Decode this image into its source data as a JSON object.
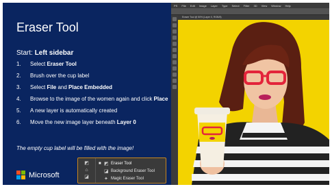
{
  "slide": {
    "title": "Eraser Tool",
    "start_prefix": "Start: ",
    "start_bold": "Left sidebar",
    "steps": [
      {
        "num": "1.",
        "pre": "Select ",
        "bold": "Eraser Tool",
        "mid": "",
        "bold2": "",
        "post": ""
      },
      {
        "num": "2.",
        "pre": "Brush over the cup label",
        "bold": "",
        "mid": "",
        "bold2": "",
        "post": ""
      },
      {
        "num": "3.",
        "pre": "Select ",
        "bold": "File",
        "mid": " and ",
        "bold2": "Place Embedded",
        "post": ""
      },
      {
        "num": "4.",
        "pre": "Browse to the image of the women again and click ",
        "bold": "Place",
        "mid": "",
        "bold2": "",
        "post": ""
      },
      {
        "num": "5.",
        "pre": "A new layer is automatically created",
        "bold": "",
        "mid": "",
        "bold2": "",
        "post": ""
      },
      {
        "num": "6.",
        "pre": "Move the new image layer beneath ",
        "bold": "Layer 0",
        "mid": "",
        "bold2": "",
        "post": ""
      }
    ],
    "note": "The empty cup label will be filled with the image!",
    "brand": "Microsoft"
  },
  "tool_popup": {
    "items": [
      {
        "label": "Eraser Tool",
        "icon": "eraser-icon",
        "active": true
      },
      {
        "label": "Background Eraser Tool",
        "icon": "background-eraser-icon",
        "active": false
      },
      {
        "label": "Magic Eraser Tool",
        "icon": "magic-eraser-icon",
        "active": false
      }
    ]
  },
  "photoshop": {
    "menus": [
      "PS",
      "File",
      "Edit",
      "Image",
      "Layer",
      "Type",
      "Select",
      "Filter",
      "3D",
      "View",
      "Window",
      "Help"
    ],
    "doc_tab": "Eraser Tool @ 50% (Layer 0, RGB/8)"
  },
  "colors": {
    "panel_bg": "#0a2560",
    "photo_bg": "#f3d300",
    "ms_red": "#f25022",
    "ms_green": "#7fba00",
    "ms_blue": "#00a4ef",
    "ms_yellow": "#ffb900",
    "popup_border": "#c8861e"
  }
}
